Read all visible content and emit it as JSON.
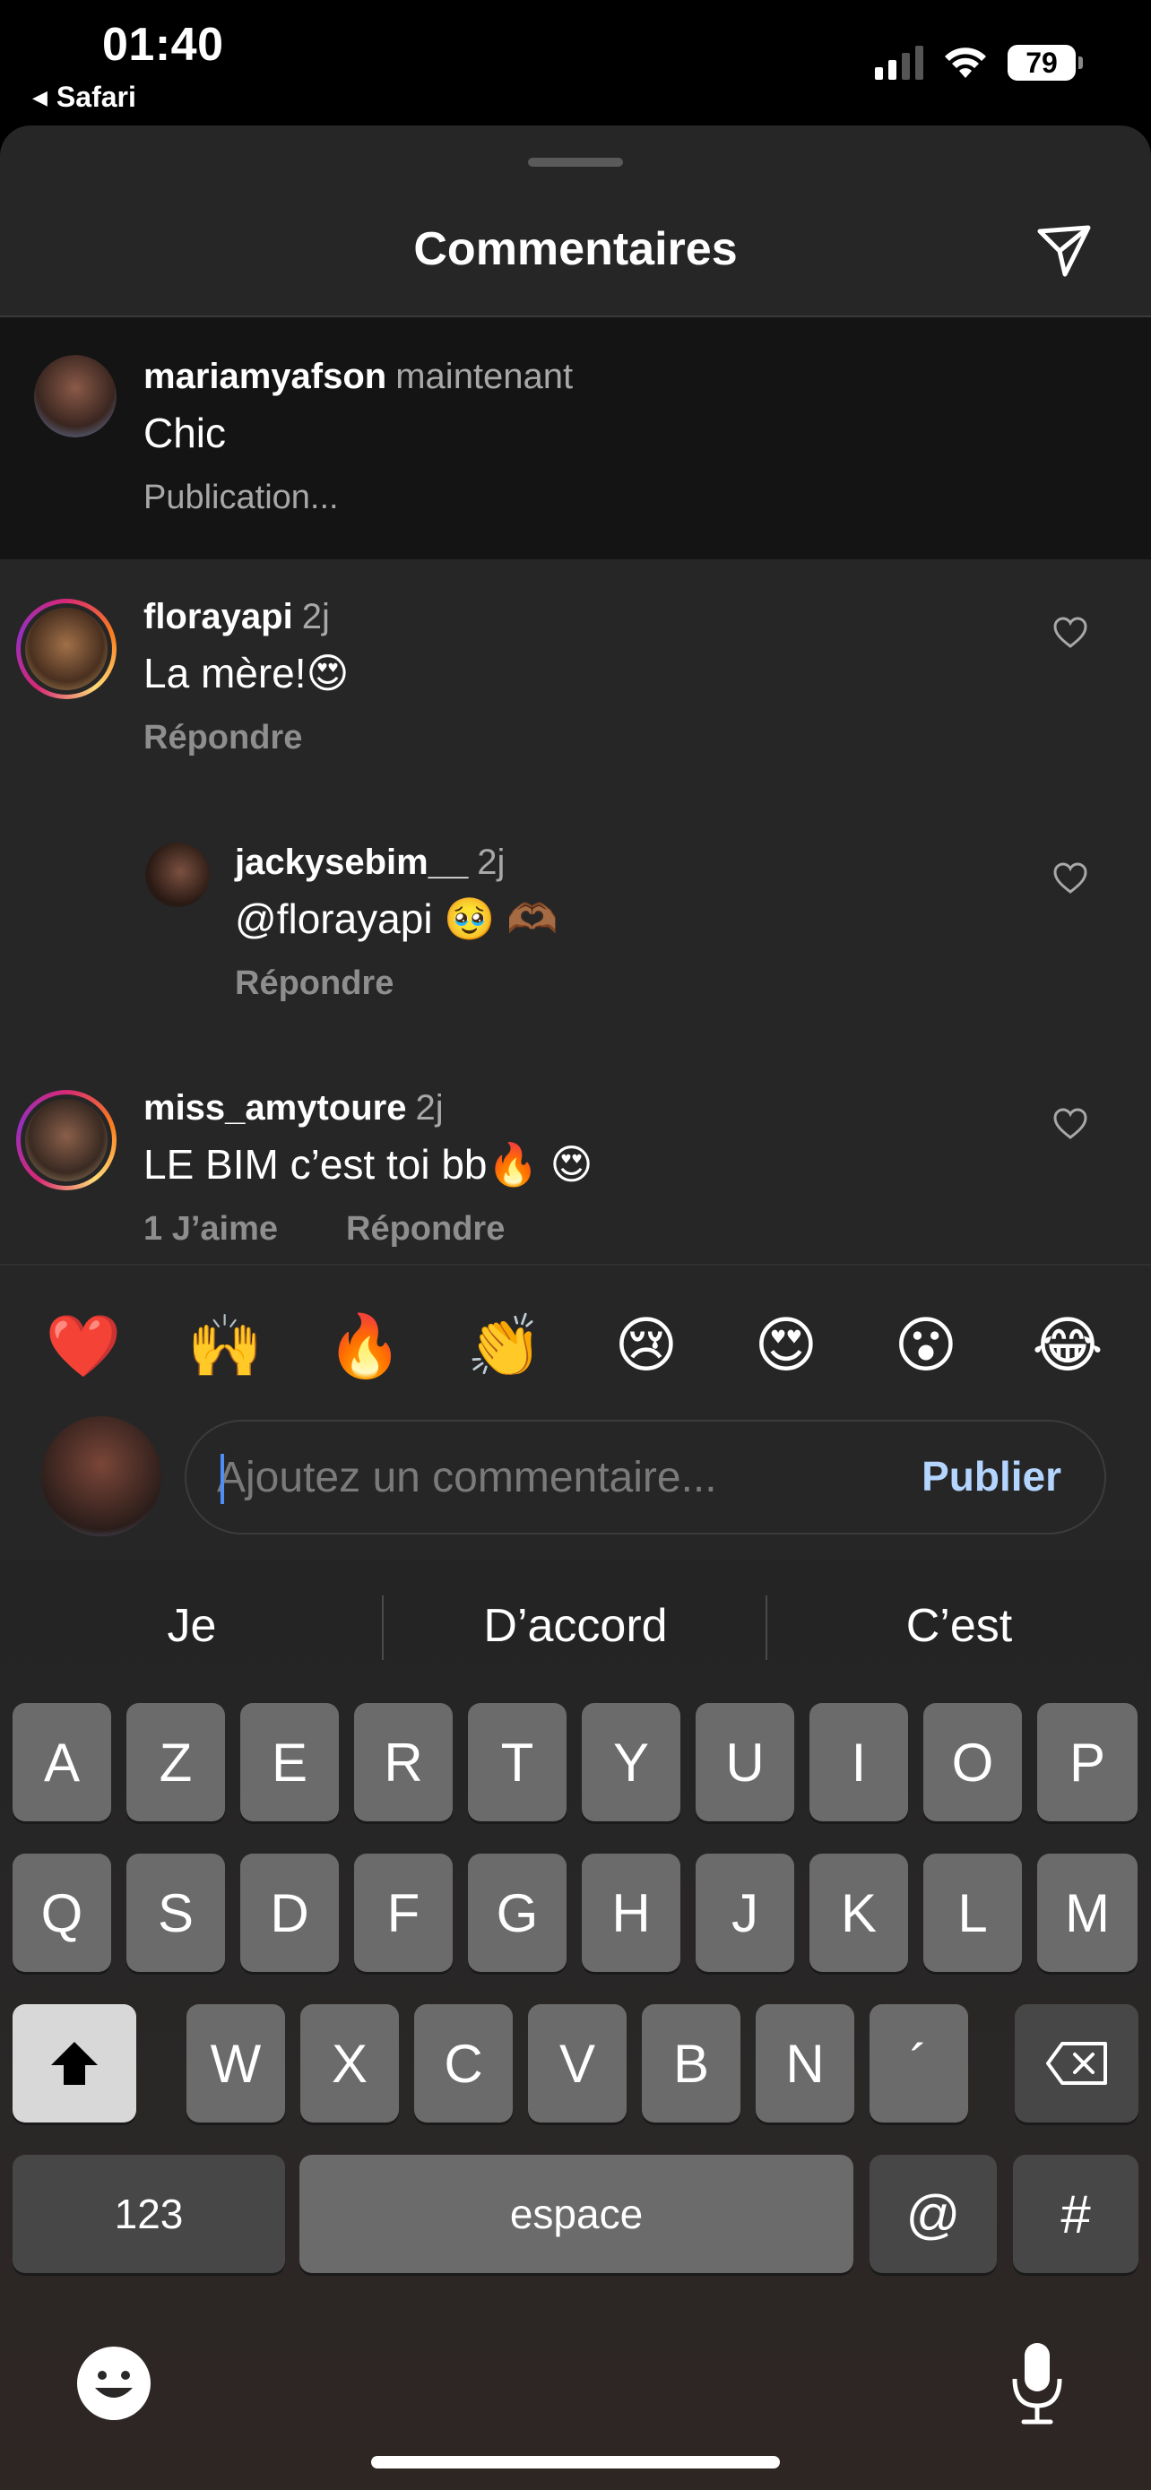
{
  "status_bar": {
    "time": "01:40",
    "back_label": "Safari",
    "battery": "79"
  },
  "sheet": {
    "title": "Commentaires"
  },
  "own_comment": {
    "username": "mariamyafson",
    "time": "maintenant",
    "text": "Chic",
    "status": "Publication..."
  },
  "comments": [
    {
      "username": "florayapi",
      "time": "2j",
      "text": "La mère!😍",
      "reply_label": "Répondre"
    },
    {
      "username": "jackysebim__",
      "time": "2j",
      "text": "@florayapi 🥹 🫶🏾",
      "reply_label": "Répondre"
    },
    {
      "username": "miss_amytoure",
      "time": "2j",
      "text": "LE BIM c’est toi bb🔥 😍",
      "likes_label": "1 J’aime",
      "reply_label": "Répondre"
    }
  ],
  "emoji_bar": [
    "❤️",
    "🙌",
    "🔥",
    "👏",
    "😢",
    "😍",
    "😮",
    "😂"
  ],
  "composer": {
    "placeholder": "Ajoutez un commentaire...",
    "publish_label": "Publier"
  },
  "keyboard": {
    "suggestions": [
      "Je",
      "D’accord",
      "C’est"
    ],
    "row1": [
      "A",
      "Z",
      "E",
      "R",
      "T",
      "Y",
      "U",
      "I",
      "O",
      "P"
    ],
    "row2": [
      "Q",
      "S",
      "D",
      "F",
      "G",
      "H",
      "J",
      "K",
      "L",
      "M"
    ],
    "row3": [
      "W",
      "X",
      "C",
      "V",
      "B",
      "N",
      "´"
    ],
    "numbers_label": "123",
    "space_label": "espace",
    "at_label": "@",
    "hash_label": "#"
  }
}
